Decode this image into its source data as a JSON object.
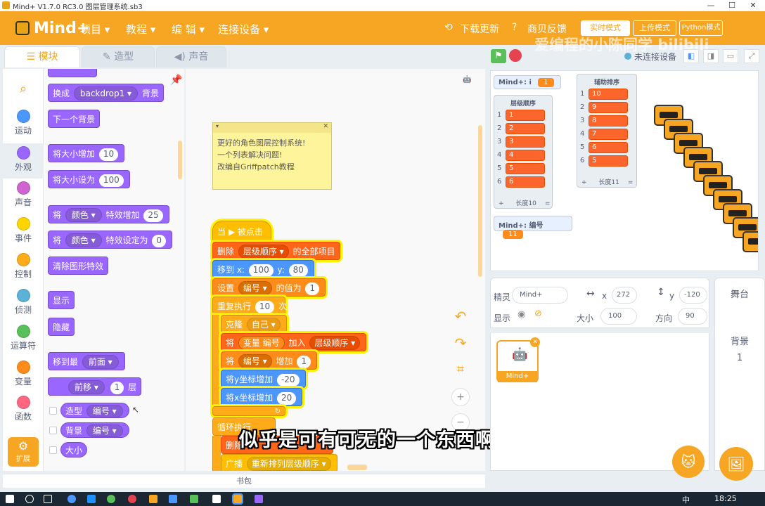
{
  "titlebar": {
    "title": "Mind+ V1.7.0 RC3.0   图层管理系统.sb3"
  },
  "menubar": {
    "brand": "Mind+",
    "items": [
      "项目 ▾",
      "教程 ▾",
      "编 辑 ▾",
      "连接设备 ▾"
    ],
    "right": [
      "下载更新",
      "商贝反馈"
    ],
    "mode": "实时模式",
    "mode2": "上传模式",
    "python": "Python模式",
    "watermark": "爱编程的小陈同学  bilibili"
  },
  "tabs": {
    "blocks": "模块",
    "costumes": "造型",
    "sounds": "声音"
  },
  "categories": [
    {
      "label": "运动",
      "color": "#4c97ff"
    },
    {
      "label": "外观",
      "color": "#9966ff"
    },
    {
      "label": "声音",
      "color": "#cf63cf"
    },
    {
      "label": "事件",
      "color": "#ffd500"
    },
    {
      "label": "控制",
      "color": "#ffab19"
    },
    {
      "label": "侦测",
      "color": "#5cb1d6"
    },
    {
      "label": "运算符",
      "color": "#59c059"
    },
    {
      "label": "变量",
      "color": "#ff8c1a"
    },
    {
      "label": "函数",
      "color": "#ff6680"
    }
  ],
  "ext_label": "扩展",
  "palette": {
    "switch_backdrop": "换成",
    "backdrop_value": "backdrop1 ▾",
    "backdrop_suffix": "背景",
    "next_backdrop": "下一个背景",
    "change_size": "将大小增加",
    "change_size_val": "10",
    "set_size": "将大小设为",
    "set_size_val": "100",
    "effect_prefix": "将",
    "effect_color": "颜色 ▾",
    "change_effect": "特效增加",
    "change_effect_val": "25",
    "set_effect": "特效设定为",
    "set_effect_val": "0",
    "clear_effects": "清除图形特效",
    "show": "显示",
    "hide": "隐藏",
    "goto_layer": "移到最",
    "goto_layer_val": "前面 ▾",
    "move_layer_dir": "前移 ▾",
    "move_layer_val": "1",
    "move_layer_suffix": "层",
    "costume_report": "造型",
    "costume_report_val": "编号 ▾",
    "backdrop_report": "背景",
    "backdrop_report_val": "编号 ▾",
    "size_report": "大小"
  },
  "note": {
    "line1": "更好的角色图层控制系统!",
    "line2": "一个列表解决问题!",
    "line3": "改编自Griffpatch教程"
  },
  "script": {
    "hat": "当 ▶ 被点击",
    "delete_all": "删除",
    "delete_list": "层级顺序 ▾",
    "delete_all_suffix": "的全部项目",
    "goto": "移到 x:",
    "goto_x": "100",
    "goto_y_label": "y:",
    "goto_y": "80",
    "set_var": "设置",
    "set_var_name": "编号 ▾",
    "set_var_mid": "的值为",
    "set_var_val": "1",
    "repeat": "重复执行",
    "repeat_val": "10",
    "repeat_suffix": "次",
    "clone": "克隆",
    "clone_val": "自己 ▾",
    "add_prefix": "将",
    "add_var": "变量 编号",
    "add_mid": "加入",
    "add_list": "层级顺序 ▾",
    "change_var": "将",
    "change_var_name": "编号 ▾",
    "change_var_mid": "增加",
    "change_var_val": "1",
    "change_y": "将y坐标增加",
    "change_y_val": "-20",
    "change_x": "将x坐标增加",
    "change_x_val": "20",
    "forever": "循环执行",
    "delete_item": "删除",
    "broadcast": "广播",
    "broadcast_val": "重新排列层级顺序 ▾"
  },
  "bottombar": "书包",
  "stage": {
    "mon_i_label": "Mind+: i",
    "mon_i_val": "1",
    "mon_num_label": "Mind+: 编号",
    "mon_num_val": "11",
    "list1_title": "层级顺序",
    "list1_items": [
      "1",
      "2",
      "3",
      "4",
      "5",
      "6"
    ],
    "list1_len": "长度10",
    "list2_title": "辅助排序",
    "list2_items": [
      "10",
      "9",
      "8",
      "7",
      "6",
      "5"
    ],
    "list2_len": "长度11",
    "not_connected": "未连接设备"
  },
  "sprite": {
    "label": "精灵",
    "name": "Mind+",
    "x_label": "x",
    "x": "272",
    "y_label": "y",
    "y": "-120",
    "show_label": "显示",
    "size_label": "大小",
    "size": "100",
    "dir_label": "方向",
    "dir": "90",
    "thumb_name": "Mind+"
  },
  "stage_panel": {
    "title": "舞台",
    "backdrop_label": "背景",
    "backdrop_count": "1"
  },
  "subtitle": "似乎是可有可无的一个东西啊",
  "taskbar": {
    "ime": "中",
    "time": "18:25"
  },
  "colors": {
    "accent": "#f6a623",
    "looks": "#9966ff",
    "variables": "#ff8c1a",
    "lists": "#ff661a",
    "motion": "#4c97ff",
    "control": "#ffab19"
  }
}
